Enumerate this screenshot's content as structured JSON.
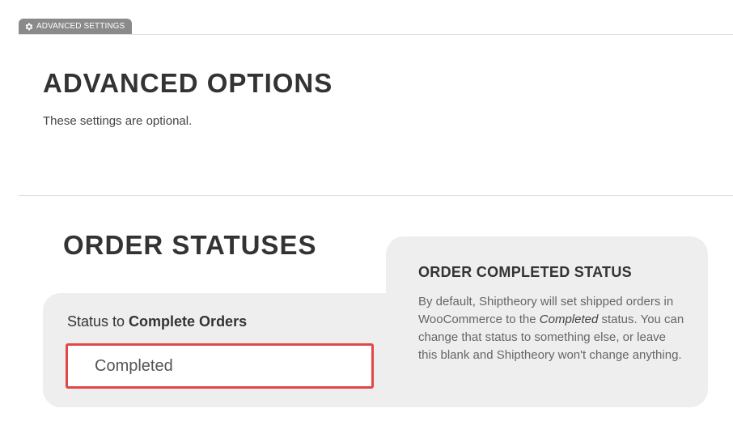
{
  "tab": {
    "label": "ADVANCED SETTINGS",
    "icon": "gear-icon"
  },
  "header": {
    "title": "ADVANCED OPTIONS",
    "subtitle": "These settings are optional."
  },
  "section": {
    "title": "ORDER STATUSES"
  },
  "field": {
    "label_prefix": "Status to ",
    "label_strong": "Complete Orders",
    "value": "Completed",
    "highlight_color": "#e04848"
  },
  "help": {
    "title": "ORDER COMPLETED STATUS",
    "text_before": "By default, Shiptheory will set shipped orders in WooCommerce to the ",
    "text_emphasis": "Completed",
    "text_after": " status. You can change that status to something else, or leave this blank and Shiptheory won't change anything."
  }
}
